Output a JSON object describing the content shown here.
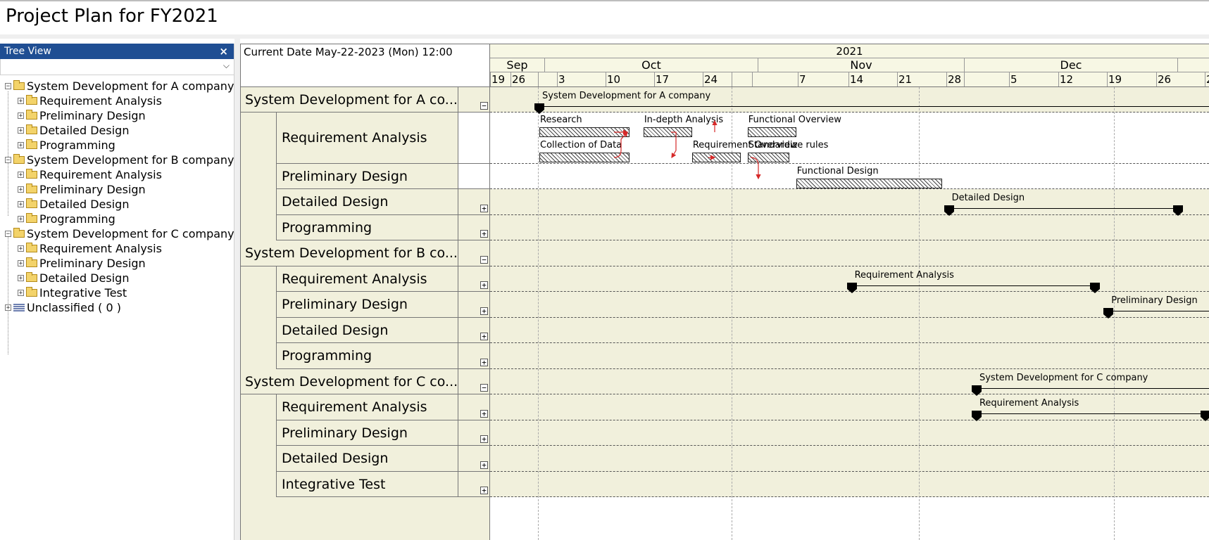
{
  "page": {
    "title": "Project Plan for FY2021"
  },
  "tree_view": {
    "title": "Tree View",
    "close_glyph": "×",
    "combo_value": "",
    "combo_arrow": "⌵",
    "nodes": [
      {
        "label": "System Development for A company",
        "level": 0,
        "icon": "folder-icon",
        "expander": "⊟"
      },
      {
        "label": "Requirement Analysis",
        "level": 1,
        "icon": "folder-icon",
        "expander": "⊞"
      },
      {
        "label": "Preliminary Design",
        "level": 1,
        "icon": "folder-icon",
        "expander": "⊞"
      },
      {
        "label": "Detailed Design",
        "level": 1,
        "icon": "folder-icon",
        "expander": "⊞"
      },
      {
        "label": "Programming",
        "level": 1,
        "icon": "folder-icon",
        "expander": "⊞"
      },
      {
        "label": "System Development for B company",
        "level": 0,
        "icon": "folder-icon",
        "expander": "⊟"
      },
      {
        "label": "Requirement Analysis",
        "level": 1,
        "icon": "folder-icon",
        "expander": "⊞"
      },
      {
        "label": "Preliminary Design",
        "level": 1,
        "icon": "folder-icon",
        "expander": "⊞"
      },
      {
        "label": "Detailed Design",
        "level": 1,
        "icon": "folder-icon",
        "expander": "⊞"
      },
      {
        "label": "Programming",
        "level": 1,
        "icon": "folder-icon",
        "expander": "⊞"
      },
      {
        "label": "System Development for C company",
        "level": 0,
        "icon": "folder-icon",
        "expander": "⊟"
      },
      {
        "label": "Requirement Analysis",
        "level": 1,
        "icon": "folder-icon",
        "expander": "⊞"
      },
      {
        "label": "Preliminary Design",
        "level": 1,
        "icon": "folder-icon",
        "expander": "⊞"
      },
      {
        "label": "Detailed Design",
        "level": 1,
        "icon": "folder-icon",
        "expander": "⊞"
      },
      {
        "label": "Integrative Test",
        "level": 1,
        "icon": "folder-icon",
        "expander": "⊞"
      },
      {
        "label": "Unclassified ( 0 )",
        "level": 0,
        "icon": "stack-icon",
        "expander": "⊞"
      }
    ]
  },
  "gantt": {
    "current_date": "Current Date May-22-2023 (Mon) 12:00",
    "year": "2021",
    "months": [
      "Sep",
      "Oct",
      "Nov",
      "Dec"
    ],
    "days": [
      "19",
      "26",
      "3",
      "10",
      "17",
      "24",
      "7",
      "14",
      "21",
      "28",
      "5",
      "12",
      "19",
      "26",
      "2"
    ],
    "rows": [
      {
        "label": "System Development for A co...",
        "parent": true,
        "ctl": "⊟",
        "box": "tan"
      },
      {
        "label": "Requirement Analysis",
        "parent": false,
        "ctl": "",
        "box": "white"
      },
      {
        "label": "Preliminary Design",
        "parent": false,
        "ctl": "",
        "box": "white"
      },
      {
        "label": "Detailed Design",
        "parent": false,
        "ctl": "⊞",
        "box": "tan"
      },
      {
        "label": "Programming",
        "parent": false,
        "ctl": "⊞",
        "box": "tan"
      },
      {
        "label": "System Development for B co...",
        "parent": true,
        "ctl": "⊟",
        "box": "tan"
      },
      {
        "label": "Requirement Analysis",
        "parent": false,
        "ctl": "⊞",
        "box": "tan"
      },
      {
        "label": "Preliminary Design",
        "parent": false,
        "ctl": "⊞",
        "box": "tan"
      },
      {
        "label": "Detailed Design",
        "parent": false,
        "ctl": "⊞",
        "box": "tan"
      },
      {
        "label": "Programming",
        "parent": false,
        "ctl": "⊞",
        "box": "tan"
      },
      {
        "label": "System Development for C co...",
        "parent": true,
        "ctl": "⊟",
        "box": "tan"
      },
      {
        "label": "Requirement Analysis",
        "parent": false,
        "ctl": "⊞",
        "box": "tan"
      },
      {
        "label": "Preliminary Design",
        "parent": false,
        "ctl": "⊞",
        "box": "tan"
      },
      {
        "label": "Detailed Design",
        "parent": false,
        "ctl": "⊞",
        "box": "tan"
      },
      {
        "label": "Integrative Test",
        "parent": false,
        "ctl": "⊞",
        "box": "tan"
      }
    ],
    "tasks": [
      {
        "label": "Research",
        "start": "2021-09-30",
        "end": "2021-10-13"
      },
      {
        "label": "In-depth Analysis",
        "start": "2021-10-15",
        "end": "2021-10-22"
      },
      {
        "label": "Functional Overview",
        "start": "2021-10-30",
        "end": "2021-11-06"
      },
      {
        "label": "Collection of Data",
        "start": "2021-09-30",
        "end": "2021-10-13"
      },
      {
        "label": "Requirement Overview",
        "start": "2021-10-22",
        "end": "2021-10-29"
      },
      {
        "label": "Standardize rules",
        "start": "2021-10-30",
        "end": "2021-11-05"
      },
      {
        "label": "Functional Design",
        "start": "2021-11-06",
        "end": "2021-11-27"
      }
    ],
    "summaries": [
      {
        "label": "System Development for A company",
        "start": "2021-09-30",
        "end": "open"
      },
      {
        "label": "Detailed Design",
        "start": "2021-11-28",
        "end": "2021-12-31"
      },
      {
        "label": "Requirement Analysis",
        "start": "2021-11-14",
        "end": "2021-12-19"
      },
      {
        "label": "Preliminary Design",
        "start": "2021-12-21",
        "end": "open"
      },
      {
        "label": "System Development for C company",
        "start": "2021-12-02",
        "end": "open"
      },
      {
        "label": "Requirement Analysis",
        "start": "2021-12-02",
        "end": "2022-01-04"
      }
    ],
    "colors": {
      "header_bg": "#1f4e93",
      "row_tan": "#f1f0dc",
      "link_arrow": "#d62828"
    }
  }
}
